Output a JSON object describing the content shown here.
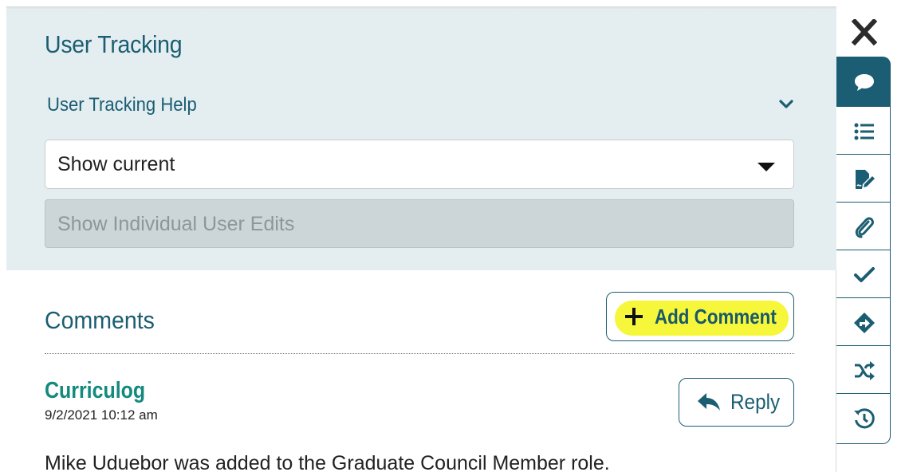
{
  "tracking": {
    "title": "User Tracking",
    "help_label": "User Tracking Help",
    "select_value": "Show current",
    "individual_edits_label": "Show Individual User Edits"
  },
  "comments": {
    "title": "Comments",
    "add_label": "Add Comment",
    "items": [
      {
        "author": "Curriculog",
        "timestamp": "9/2/2021 10:12 am",
        "reply_label": "Reply",
        "body": "Mike Uduebor was added to the Graduate Council Member role."
      }
    ]
  },
  "sidebar": {
    "items": [
      {
        "icon": "comment-icon",
        "active": true
      },
      {
        "icon": "list-icon",
        "active": false
      },
      {
        "icon": "signature-icon",
        "active": false
      },
      {
        "icon": "paperclip-icon",
        "active": false
      },
      {
        "icon": "check-icon",
        "active": false
      },
      {
        "icon": "route-icon",
        "active": false
      },
      {
        "icon": "shuffle-icon",
        "active": false
      },
      {
        "icon": "history-icon",
        "active": false
      }
    ]
  },
  "colors": {
    "brand": "#1b5d72",
    "author": "#138a7e",
    "highlight": "#f6f63a",
    "panel_bg": "#e4eef0"
  }
}
